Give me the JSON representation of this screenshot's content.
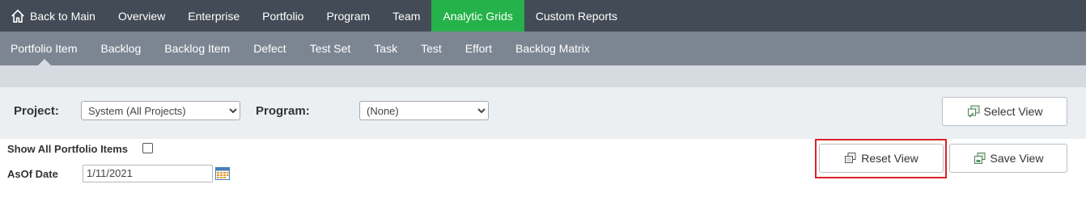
{
  "topnav": {
    "items": [
      {
        "label": "Back to Main",
        "icon": "home-icon"
      },
      {
        "label": "Overview"
      },
      {
        "label": "Enterprise"
      },
      {
        "label": "Portfolio"
      },
      {
        "label": "Program"
      },
      {
        "label": "Team"
      },
      {
        "label": "Analytic Grids",
        "active": true
      },
      {
        "label": "Custom Reports"
      }
    ],
    "active_color": "#25b24a",
    "bg_color": "#434b56"
  },
  "subnav": {
    "items": [
      {
        "label": "Portfolio Item",
        "active": true
      },
      {
        "label": "Backlog"
      },
      {
        "label": "Backlog Item"
      },
      {
        "label": "Defect"
      },
      {
        "label": "Test Set"
      },
      {
        "label": "Task"
      },
      {
        "label": "Test"
      },
      {
        "label": "Effort"
      },
      {
        "label": "Backlog Matrix"
      }
    ],
    "bg_color": "#7c8693"
  },
  "filters": {
    "project_label": "Project:",
    "project_value": "System (All Projects)",
    "program_label": "Program:",
    "program_value": "(None)",
    "select_view_label": "Select View"
  },
  "options": {
    "show_all_label": "Show All Portfolio Items",
    "show_all_checked": false,
    "asof_label": "AsOf Date",
    "asof_value": "1/11/2021"
  },
  "actions": {
    "reset_view_label": "Reset View",
    "save_view_label": "Save View"
  },
  "highlight_color": "#d8232a"
}
